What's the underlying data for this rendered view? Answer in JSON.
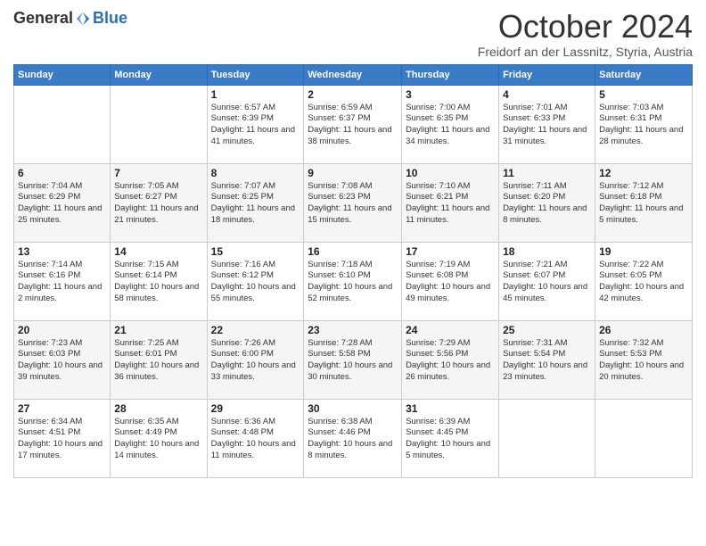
{
  "header": {
    "logo_general": "General",
    "logo_blue": "Blue",
    "title": "October 2024",
    "subtitle": "Freidorf an der Lassnitz, Styria, Austria"
  },
  "days_of_week": [
    "Sunday",
    "Monday",
    "Tuesday",
    "Wednesday",
    "Thursday",
    "Friday",
    "Saturday"
  ],
  "weeks": [
    [
      {
        "day": "",
        "info": ""
      },
      {
        "day": "",
        "info": ""
      },
      {
        "day": "1",
        "info": "Sunrise: 6:57 AM\nSunset: 6:39 PM\nDaylight: 11 hours and 41 minutes."
      },
      {
        "day": "2",
        "info": "Sunrise: 6:59 AM\nSunset: 6:37 PM\nDaylight: 11 hours and 38 minutes."
      },
      {
        "day": "3",
        "info": "Sunrise: 7:00 AM\nSunset: 6:35 PM\nDaylight: 11 hours and 34 minutes."
      },
      {
        "day": "4",
        "info": "Sunrise: 7:01 AM\nSunset: 6:33 PM\nDaylight: 11 hours and 31 minutes."
      },
      {
        "day": "5",
        "info": "Sunrise: 7:03 AM\nSunset: 6:31 PM\nDaylight: 11 hours and 28 minutes."
      }
    ],
    [
      {
        "day": "6",
        "info": "Sunrise: 7:04 AM\nSunset: 6:29 PM\nDaylight: 11 hours and 25 minutes."
      },
      {
        "day": "7",
        "info": "Sunrise: 7:05 AM\nSunset: 6:27 PM\nDaylight: 11 hours and 21 minutes."
      },
      {
        "day": "8",
        "info": "Sunrise: 7:07 AM\nSunset: 6:25 PM\nDaylight: 11 hours and 18 minutes."
      },
      {
        "day": "9",
        "info": "Sunrise: 7:08 AM\nSunset: 6:23 PM\nDaylight: 11 hours and 15 minutes."
      },
      {
        "day": "10",
        "info": "Sunrise: 7:10 AM\nSunset: 6:21 PM\nDaylight: 11 hours and 11 minutes."
      },
      {
        "day": "11",
        "info": "Sunrise: 7:11 AM\nSunset: 6:20 PM\nDaylight: 11 hours and 8 minutes."
      },
      {
        "day": "12",
        "info": "Sunrise: 7:12 AM\nSunset: 6:18 PM\nDaylight: 11 hours and 5 minutes."
      }
    ],
    [
      {
        "day": "13",
        "info": "Sunrise: 7:14 AM\nSunset: 6:16 PM\nDaylight: 11 hours and 2 minutes."
      },
      {
        "day": "14",
        "info": "Sunrise: 7:15 AM\nSunset: 6:14 PM\nDaylight: 10 hours and 58 minutes."
      },
      {
        "day": "15",
        "info": "Sunrise: 7:16 AM\nSunset: 6:12 PM\nDaylight: 10 hours and 55 minutes."
      },
      {
        "day": "16",
        "info": "Sunrise: 7:18 AM\nSunset: 6:10 PM\nDaylight: 10 hours and 52 minutes."
      },
      {
        "day": "17",
        "info": "Sunrise: 7:19 AM\nSunset: 6:08 PM\nDaylight: 10 hours and 49 minutes."
      },
      {
        "day": "18",
        "info": "Sunrise: 7:21 AM\nSunset: 6:07 PM\nDaylight: 10 hours and 45 minutes."
      },
      {
        "day": "19",
        "info": "Sunrise: 7:22 AM\nSunset: 6:05 PM\nDaylight: 10 hours and 42 minutes."
      }
    ],
    [
      {
        "day": "20",
        "info": "Sunrise: 7:23 AM\nSunset: 6:03 PM\nDaylight: 10 hours and 39 minutes."
      },
      {
        "day": "21",
        "info": "Sunrise: 7:25 AM\nSunset: 6:01 PM\nDaylight: 10 hours and 36 minutes."
      },
      {
        "day": "22",
        "info": "Sunrise: 7:26 AM\nSunset: 6:00 PM\nDaylight: 10 hours and 33 minutes."
      },
      {
        "day": "23",
        "info": "Sunrise: 7:28 AM\nSunset: 5:58 PM\nDaylight: 10 hours and 30 minutes."
      },
      {
        "day": "24",
        "info": "Sunrise: 7:29 AM\nSunset: 5:56 PM\nDaylight: 10 hours and 26 minutes."
      },
      {
        "day": "25",
        "info": "Sunrise: 7:31 AM\nSunset: 5:54 PM\nDaylight: 10 hours and 23 minutes."
      },
      {
        "day": "26",
        "info": "Sunrise: 7:32 AM\nSunset: 5:53 PM\nDaylight: 10 hours and 20 minutes."
      }
    ],
    [
      {
        "day": "27",
        "info": "Sunrise: 6:34 AM\nSunset: 4:51 PM\nDaylight: 10 hours and 17 minutes."
      },
      {
        "day": "28",
        "info": "Sunrise: 6:35 AM\nSunset: 4:49 PM\nDaylight: 10 hours and 14 minutes."
      },
      {
        "day": "29",
        "info": "Sunrise: 6:36 AM\nSunset: 4:48 PM\nDaylight: 10 hours and 11 minutes."
      },
      {
        "day": "30",
        "info": "Sunrise: 6:38 AM\nSunset: 4:46 PM\nDaylight: 10 hours and 8 minutes."
      },
      {
        "day": "31",
        "info": "Sunrise: 6:39 AM\nSunset: 4:45 PM\nDaylight: 10 hours and 5 minutes."
      },
      {
        "day": "",
        "info": ""
      },
      {
        "day": "",
        "info": ""
      }
    ]
  ]
}
